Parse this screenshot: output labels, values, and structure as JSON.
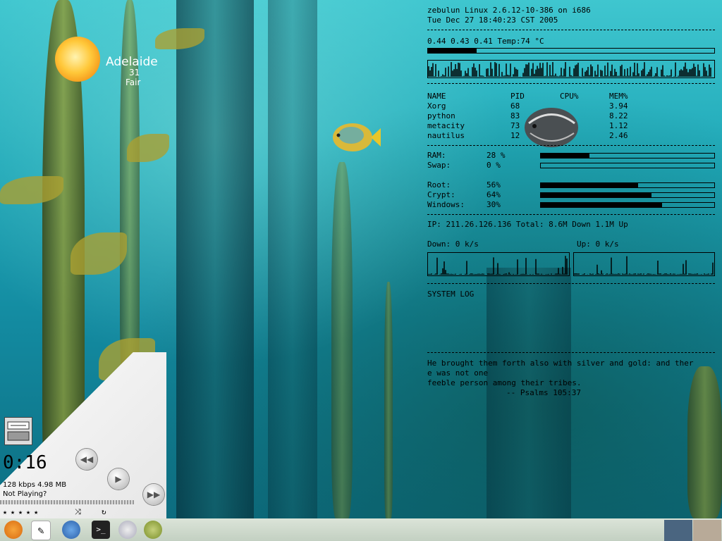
{
  "weather": {
    "city": "Adelaide",
    "temperature": "31",
    "condition": "Fair"
  },
  "conky": {
    "header_line": "zebulun Linux 2.6.12-10-386 on i686",
    "datetime": "Tue Dec 27 18:40:23 CST 2005",
    "load_line": "0.44 0.43 0.41 Temp:74  °C",
    "cpu_bar_fraction": 0.17,
    "processes": {
      "headers": [
        "NAME",
        "PID",
        "CPU%",
        "MEM%"
      ],
      "rows": [
        [
          "Xorg",
          "68",
          "",
          "3.94"
        ],
        [
          "python",
          "83",
          "",
          "8.22"
        ],
        [
          "metacity",
          "73",
          "",
          "1.12"
        ],
        [
          "nautilus",
          "12",
          "",
          "2.46"
        ]
      ]
    },
    "memory": [
      {
        "label": "RAM:",
        "value": "28 %",
        "fraction": 0.28
      },
      {
        "label": "Swap:",
        "value": "0  %",
        "fraction": 0.0
      }
    ],
    "disks": [
      {
        "label": "Root:",
        "value": "56%",
        "fraction": 0.56
      },
      {
        "label": "Crypt:",
        "value": "64%",
        "fraction": 0.64
      },
      {
        "label": "Windows:",
        "value": "30%",
        "fraction": 0.7
      }
    ],
    "network_line": "IP: 211.26.126.136 Total: 8.6M Down 1.1M Up",
    "down_label": "Down: 0     k/s",
    "up_label": "Up: 0     k/s",
    "system_log_label": "SYSTEM LOG",
    "quote_line1": "He brought them forth also with silver and gold: and ther",
    "quote_line2": "e was not one",
    "quote_line3": "feeble person among their tribes.",
    "quote_line4": "-- Psalms 105:37"
  },
  "player": {
    "time": "0:16",
    "bitrate_size": "128 kbps  4.98 MB",
    "status": "Not Playing?",
    "stars": "★★★★★"
  },
  "panel": {
    "launchers": [
      "ubuntu-menu-icon",
      "text-editor-icon",
      "firefox-icon",
      "terminal-icon",
      "browser-icon",
      "apple-icon"
    ],
    "workspaces": [
      "#4a6580",
      "#b8aa98"
    ]
  }
}
